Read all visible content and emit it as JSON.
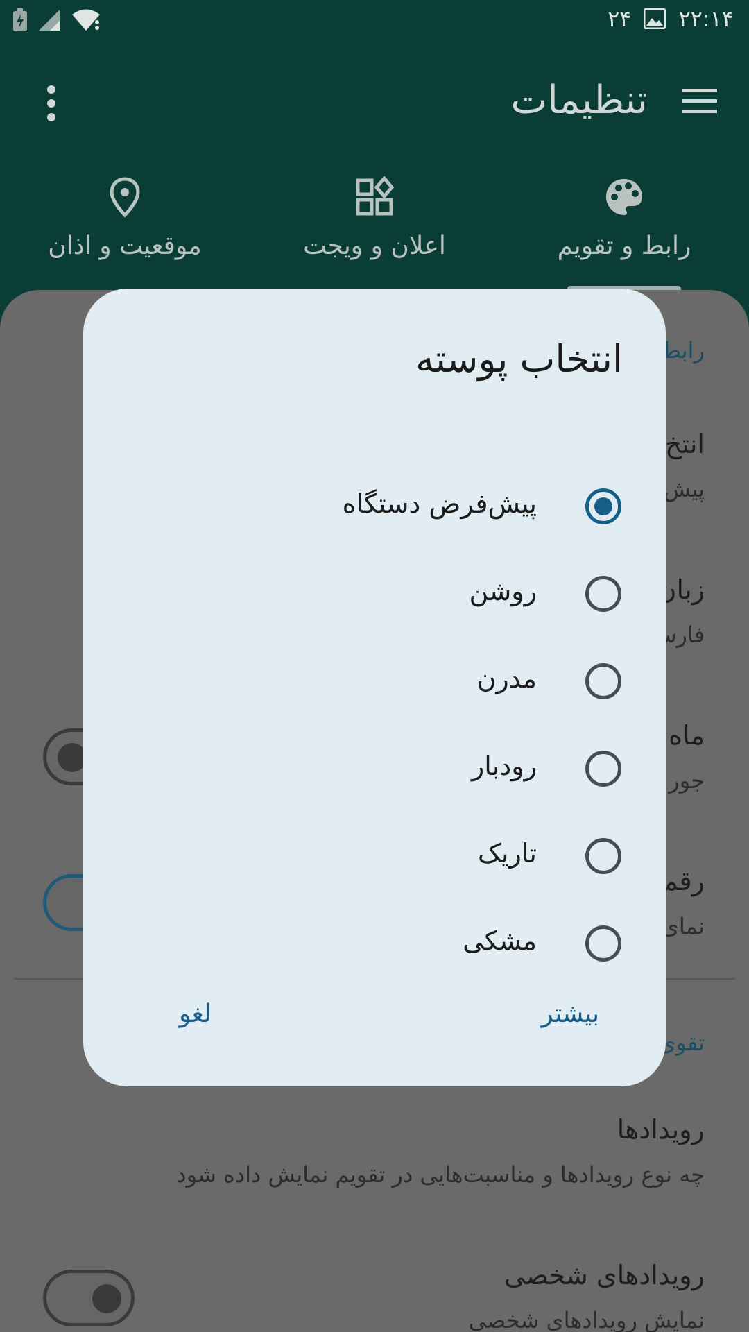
{
  "status_bar": {
    "time": "۲۲:۱۴",
    "date_day": "۲۴"
  },
  "app_bar": {
    "title": "تنظیمات"
  },
  "tabs": [
    {
      "label": "رابط و تقویم",
      "icon": "palette-icon"
    },
    {
      "label": "اعلان و ویجت",
      "icon": "widgets-icon"
    },
    {
      "label": "موقعیت و اذان",
      "icon": "location-pin-icon"
    }
  ],
  "background": {
    "section_interface": "رابط",
    "item1_title": "انتخ",
    "item1_sub": "پیش",
    "item2_title": "زبان",
    "item2_sub": "فارس",
    "item3_title": "ماه",
    "item3_sub": "جور",
    "item4_title": "رقم",
    "item4_sub": "نمای",
    "section_calendar": "تقوی",
    "events_title": "رویدادها",
    "events_sub": "چه نوع رویدادها و مناسبت‌هایی در تقویم نمایش داده شود",
    "personal_title": "رویدادهای شخصی",
    "personal_sub": "نمایش رویدادهای شخصی"
  },
  "dialog": {
    "title": "انتخاب پوسته",
    "selected_index": 0,
    "options": [
      {
        "label": "پیش‌فرض دستگاه"
      },
      {
        "label": "روشن"
      },
      {
        "label": "مدرن"
      },
      {
        "label": "رودبار"
      },
      {
        "label": "تاریک"
      },
      {
        "label": "مشکی"
      }
    ],
    "more_label": "بیشتر",
    "cancel_label": "لغو"
  },
  "colors": {
    "app_bar_bg": "#0a3d36",
    "scrim_sheet": "#6a6a6a",
    "dialog_bg": "#e2edf3",
    "accent": "#155f87"
  }
}
